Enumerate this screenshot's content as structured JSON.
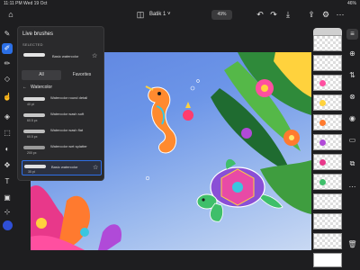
{
  "status": {
    "time_date": "11:11 PM  Wed 19 Oct",
    "battery": "46%"
  },
  "topbar": {
    "doc_name": "Batik 1 ˅",
    "zoom": "49%"
  },
  "panel": {
    "title": "Live brushes",
    "selected_label": "SELECTED",
    "selected_brush": {
      "name": "Basic watercolor",
      "size": ""
    },
    "tabs": [
      "All",
      "Favorites"
    ],
    "category": "Watercolor",
    "brushes": [
      {
        "name": "Watercolor round detail",
        "size": "40 pt"
      },
      {
        "name": "Watercolor wash soft",
        "size": "60.5 px"
      },
      {
        "name": "Watercolor wash flat",
        "size": "60.5 px"
      },
      {
        "name": "Watercolor wet splatter",
        "size": "200 px"
      },
      {
        "name": "Basic watercolor",
        "size": "35 pt"
      }
    ]
  },
  "colors": {
    "accent": "#2b6fe6",
    "current_color": "#2f4fd6"
  },
  "icons": {
    "topbar": [
      "home-icon",
      "layers-icon",
      "undo-icon",
      "redo-icon",
      "download-icon",
      "share-icon",
      "settings-icon"
    ],
    "left_tools": [
      "pen-icon",
      "live-brush-icon",
      "pixel-brush-icon",
      "eraser-icon",
      "smudge-icon",
      "fill-icon",
      "selection-icon",
      "transform-icon",
      "text-icon",
      "image-icon"
    ],
    "right_tools": [
      "layer-add-icon",
      "blend-icon",
      "visibility-icon",
      "lock-icon",
      "more-icon",
      "merge-icon",
      "delete-icon"
    ]
  }
}
